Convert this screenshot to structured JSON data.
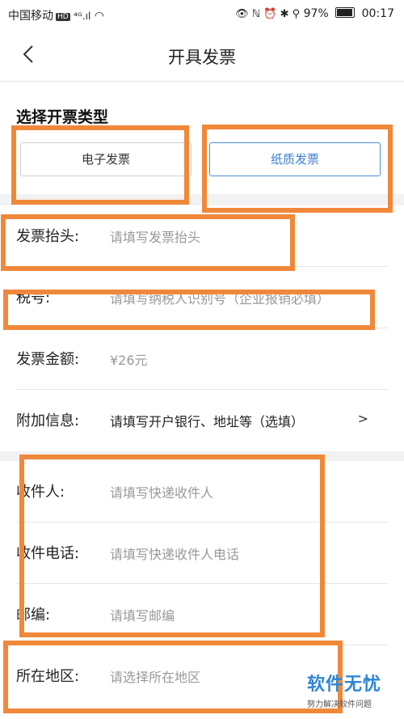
{
  "status_bar": {
    "carrier": "中国移动",
    "hd": "HD",
    "signal": "⁴ᴳ.ıl",
    "wifi": "◠",
    "right_icons": "👁 ℕ ⏰ ✱ ⚲",
    "battery_percent": "97%",
    "battery_level": 0.97,
    "time": "00:17"
  },
  "nav": {
    "title": "开具发票"
  },
  "invoice_type": {
    "section_title": "选择开票类型",
    "electronic_label": "电子发票",
    "paper_label": "纸质发票",
    "selected": "paper"
  },
  "form": {
    "title_row": {
      "label": "发票抬头:",
      "placeholder": "请填写发票抬头"
    },
    "tax_row": {
      "label": "税号:",
      "placeholder": "请填写纳税人识别号（企业报销必填）"
    },
    "amount_row": {
      "label": "发票金额:",
      "value": "¥26元"
    },
    "extra_row": {
      "label": "附加信息:",
      "placeholder": "请填写开户银行、地址等（选填）",
      "chevron": ">"
    }
  },
  "shipping": {
    "recipient_row": {
      "label": "收件人:",
      "placeholder": "请填写快递收件人"
    },
    "phone_row": {
      "label": "收件电话:",
      "placeholder": "请填写快递收件人电话"
    },
    "zip_row": {
      "label": "邮编:",
      "placeholder": "请填写邮编"
    },
    "region_row": {
      "label": "所在地区:",
      "placeholder": "请选择所在地区"
    }
  },
  "watermark": {
    "title": "软件无忧",
    "subtitle": "努力解决软件问题"
  },
  "colors": {
    "annotation": "#f0883a",
    "accent_blue": "#3a7fd0",
    "placeholder_gray": "#999999"
  }
}
